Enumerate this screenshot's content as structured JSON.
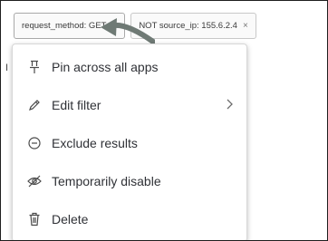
{
  "filter_pills": [
    {
      "label": "request_method: GET",
      "close": "×"
    },
    {
      "label": "NOT source_ip: 155.6.2.4",
      "close": "×"
    }
  ],
  "left_edge_glyph": "I",
  "context_menu": {
    "items": [
      {
        "label": "Pin across all apps",
        "icon": "pin-icon"
      },
      {
        "label": "Edit filter",
        "icon": "pencil-icon",
        "has_submenu": true
      },
      {
        "label": "Exclude results",
        "icon": "minus-circle-icon"
      },
      {
        "label": "Temporarily disable",
        "icon": "eye-slash-icon"
      },
      {
        "label": "Delete",
        "icon": "trash-icon"
      }
    ]
  },
  "colors": {
    "annotation_arrow": "#6f7a75",
    "menu_text": "#2f3136",
    "icon_stroke": "#4a4a4a"
  }
}
